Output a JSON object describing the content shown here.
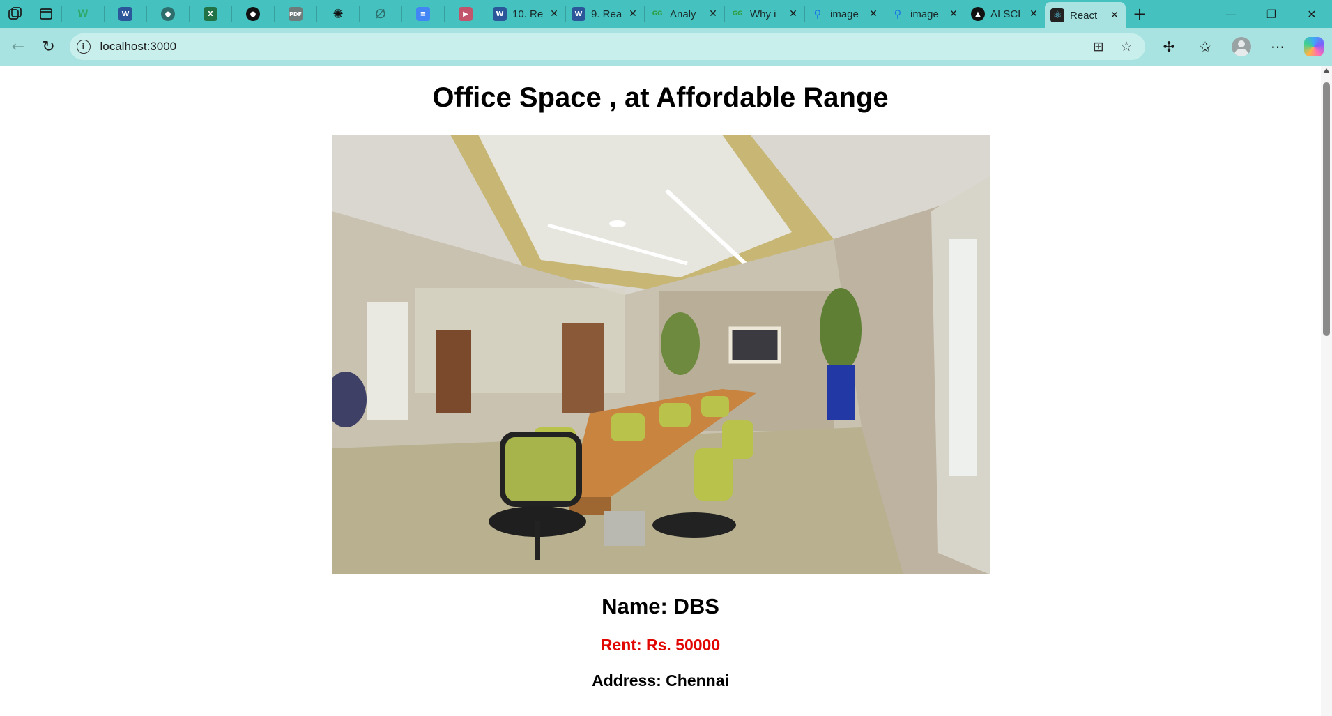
{
  "browser": {
    "tabs": [
      {
        "label": "10. Re",
        "favicon": "word-icon",
        "color": "#2b579a"
      },
      {
        "label": "9. Rea",
        "favicon": "word-icon",
        "color": "#2b579a"
      },
      {
        "label": "Analy",
        "favicon": "gg-icon",
        "color": "#2f9e44"
      },
      {
        "label": "Why i",
        "favicon": "gg-icon",
        "color": "#2f9e44"
      },
      {
        "label": "image",
        "favicon": "search-icon",
        "color": "#1a73e8"
      },
      {
        "label": "image",
        "favicon": "search-icon",
        "color": "#1a73e8"
      },
      {
        "label": "AI SCI",
        "favicon": "triangle-icon",
        "color": "#111111"
      },
      {
        "label": "React",
        "favicon": "react-icon",
        "color": "#222222",
        "active": true
      }
    ],
    "address": "localhost:3000"
  },
  "page": {
    "heading": "Office Space , at Affordable Range",
    "image_alt": "Conference room with long wooden table and green mesh chairs",
    "name_label": "Name: DBS",
    "rent_label": "Rent: Rs. 50000",
    "address_label": "Address: Chennai"
  },
  "colors": {
    "tabbar": "#45c2bf",
    "toolbar": "#a8e3e1",
    "rent_text": "#e10600"
  }
}
